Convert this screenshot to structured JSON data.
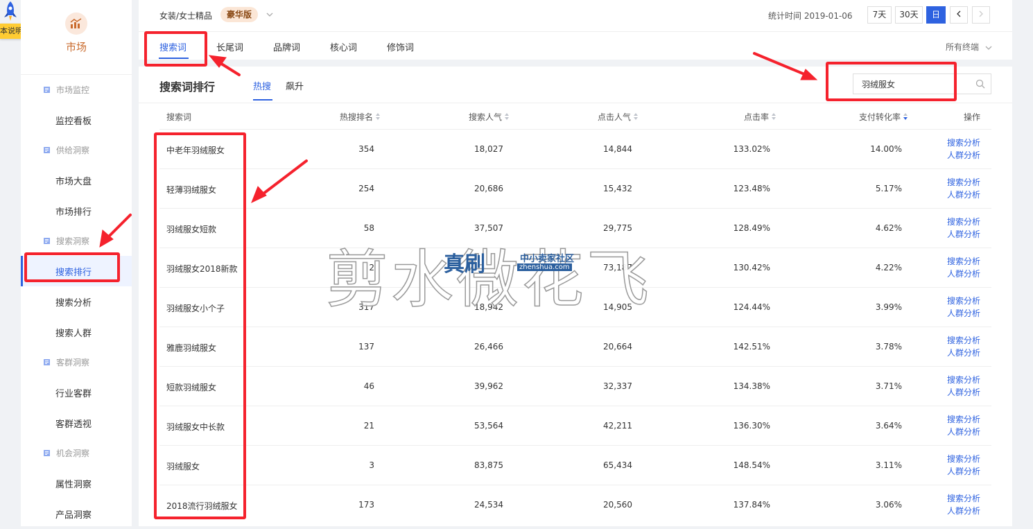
{
  "guide": {
    "label": "本说明"
  },
  "sidebar": {
    "title": "市场",
    "groups": [
      {
        "label": "市场监控",
        "items": [
          "监控看板"
        ]
      },
      {
        "label": "供给洞察",
        "items": [
          "市场大盘",
          "市场排行"
        ]
      },
      {
        "label": "搜索洞察",
        "items": [
          "搜索排行",
          "搜索分析",
          "搜索人群"
        ]
      },
      {
        "label": "客群洞察",
        "items": [
          "行业客群",
          "客群透视"
        ]
      },
      {
        "label": "机会洞察",
        "items": [
          "属性洞察",
          "产品洞察"
        ]
      }
    ],
    "active_item": "搜索排行"
  },
  "topbar": {
    "breadcrumb": "女装/女士精品",
    "edition_tag": "豪华版",
    "stat_time": "统计时间 2019-01-06",
    "range_buttons": [
      "7天",
      "30天",
      "日"
    ],
    "active_range": "日"
  },
  "tabs": {
    "items": [
      "搜索词",
      "长尾词",
      "品牌词",
      "核心词",
      "修饰词"
    ],
    "active": "搜索词",
    "terminal_select": "所有终端"
  },
  "panel": {
    "title": "搜索词排行",
    "subtabs": [
      "热搜",
      "飙升"
    ],
    "active_subtab": "热搜",
    "search_value": "羽绒服女"
  },
  "table": {
    "columns": [
      "搜索词",
      "热搜排名",
      "搜索人气",
      "点击人气",
      "点击率",
      "支付转化率",
      "操作"
    ],
    "actions": [
      "搜索分析",
      "人群分析"
    ],
    "rows": [
      {
        "term": "中老年羽绒服女",
        "rank": "354",
        "search": "18,027",
        "click": "14,844",
        "ctr": "133.02%",
        "cvr": "14.00%"
      },
      {
        "term": "轻薄羽绒服女",
        "rank": "254",
        "search": "20,686",
        "click": "15,432",
        "ctr": "123.48%",
        "cvr": "5.17%"
      },
      {
        "term": "羽绒服女短款",
        "rank": "58",
        "search": "37,507",
        "click": "29,775",
        "ctr": "128.49%",
        "cvr": "4.62%"
      },
      {
        "term": "羽绒服女2018新款",
        "rank": "2",
        "search": "",
        "click": "73,187",
        "ctr": "130.42%",
        "cvr": "4.22%"
      },
      {
        "term": "羽绒服女小个子",
        "rank": "317",
        "search": "18,942",
        "click": "14,905",
        "ctr": "124.44%",
        "cvr": "3.99%"
      },
      {
        "term": "雅鹿羽绒服女",
        "rank": "137",
        "search": "26,466",
        "click": "20,664",
        "ctr": "142.51%",
        "cvr": "3.78%"
      },
      {
        "term": "短款羽绒服女",
        "rank": "46",
        "search": "39,962",
        "click": "32,337",
        "ctr": "134.38%",
        "cvr": "3.71%"
      },
      {
        "term": "羽绒服女中长款",
        "rank": "21",
        "search": "53,564",
        "click": "42,211",
        "ctr": "136.30%",
        "cvr": "3.64%"
      },
      {
        "term": "羽绒服女",
        "rank": "3",
        "search": "83,875",
        "click": "65,434",
        "ctr": "148.54%",
        "cvr": "3.11%"
      },
      {
        "term": "2018流行羽绒服女",
        "rank": "173",
        "search": "24,534",
        "click": "20,560",
        "ctr": "137.84%",
        "cvr": "3.06%"
      }
    ]
  },
  "watermark": {
    "big_text": "剪水微花飞",
    "logo_text": "真刷",
    "sub1": "中小卖家社区",
    "sub2": "zhenshua.com"
  },
  "colors": {
    "accent": "#2e62e0",
    "annotation": "#f5222d",
    "brand": "#c96a2c"
  }
}
